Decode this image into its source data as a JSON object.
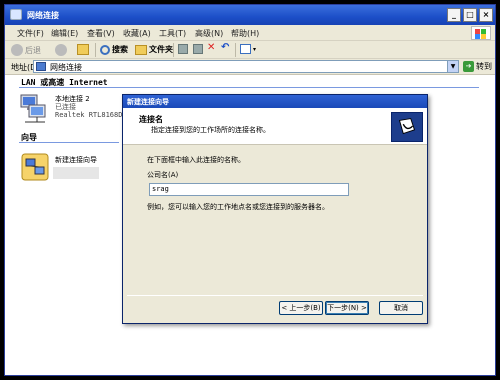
{
  "window": {
    "title": "网络连接"
  },
  "titlebar_buttons": {
    "minimize": "_",
    "maximize": "□",
    "close": "×"
  },
  "menu": [
    "文件(F)",
    "编辑(E)",
    "查看(V)",
    "收藏(A)",
    "工具(T)",
    "高级(N)",
    "帮助(H)"
  ],
  "toolbar": {
    "back": "后退",
    "search": "搜索",
    "folders": "文件夹"
  },
  "address": {
    "label": "地址(D)",
    "value": "网络连接",
    "go": "转到"
  },
  "content": {
    "group_lan": "LAN 或高速 Internet",
    "connection": {
      "name": "本地连接 2",
      "status": "已连接",
      "device": "Realtek RTL8168D..."
    },
    "group_wizard": "向导",
    "wizard_item": "新建连接向导"
  },
  "dialog": {
    "title": "新建连接向导",
    "heading": "连接名",
    "subheading": "指定连接到您的工作场所的连接名称。",
    "instruction": "在下面框中输入此连接的名称。",
    "field_label": "公司名(A)",
    "field_value": "srag",
    "example": "例如，您可以输入您的工作地点名或您连接到的服务器名。",
    "back": "< 上一步(B)",
    "next": "下一步(N) >",
    "cancel": "取消"
  }
}
